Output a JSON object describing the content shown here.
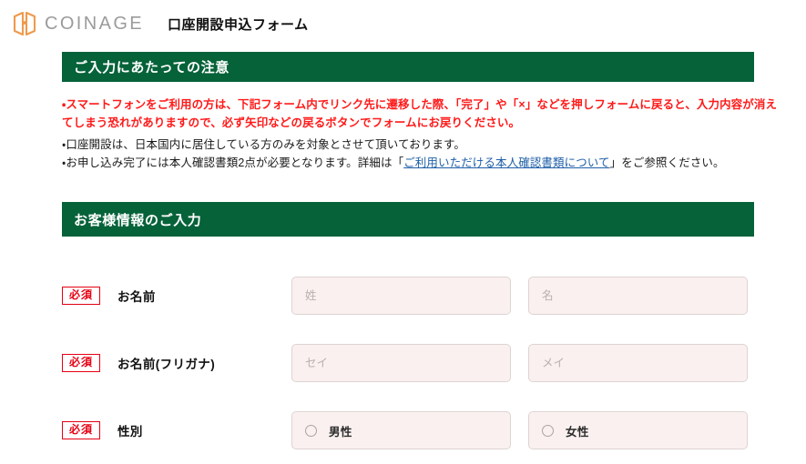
{
  "brand": {
    "logo_icon": "coinage-door-logo",
    "name": "COINAGE",
    "logo_color": "#ef9a4d"
  },
  "header": {
    "form_title": "口座開設申込フォーム"
  },
  "theme": {
    "section_green": "#066239",
    "required_red": "#e60012",
    "warning_red": "#ff1a1a",
    "link_blue": "#1f5fa8",
    "input_bg": "#f9f0ef"
  },
  "sections": {
    "notice": {
      "title": "ご入力にあたっての注意",
      "warning": "・スマートフォンをご利用の方は、下記フォーム内でリンク先に遷移した際、「完了」や「×」などを押しフォームに戻ると、入力内容が消えてしまう恐れがありますので、必ず矢印などの戻るボタンでフォームにお戻りください。",
      "items": [
        {
          "text": "・口座開設は、日本国内に居住している方のみを対象とさせて頂いております。"
        }
      ],
      "item_with_link": {
        "before": "・お申し込み完了には本人確認書類2点が必要となります。詳細は「",
        "link": "ご利用いただける本人確認書類について",
        "after": "」をご参照ください。"
      }
    },
    "customer": {
      "title": "お客様情報のご入力"
    }
  },
  "form": {
    "required_badge": "必須",
    "rows": [
      {
        "label": "お名前",
        "type": "text",
        "fields": [
          {
            "placeholder": "姓",
            "value": ""
          },
          {
            "placeholder": "名",
            "value": ""
          }
        ]
      },
      {
        "label": "お名前(フリガナ)",
        "type": "text",
        "fields": [
          {
            "placeholder": "セイ",
            "value": ""
          },
          {
            "placeholder": "メイ",
            "value": ""
          }
        ]
      },
      {
        "label": "性別",
        "type": "radio",
        "options": [
          {
            "label": "男性",
            "selected": false
          },
          {
            "label": "女性",
            "selected": false
          }
        ]
      }
    ]
  }
}
